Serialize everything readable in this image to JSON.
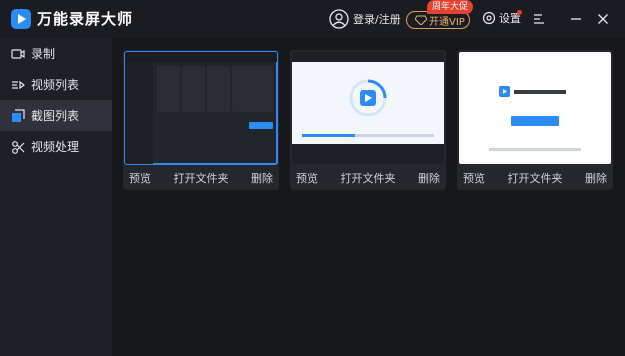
{
  "app": {
    "title": "万能录屏大师",
    "login_label": "登录/注册",
    "vip_label": "开通VIP",
    "promo_badge": "周年大促",
    "settings_label": "设置",
    "accent_color": "#2b8cf5"
  },
  "sidebar": {
    "items": [
      {
        "label": "录制",
        "icon": "record-icon"
      },
      {
        "label": "视频列表",
        "icon": "video-list-icon"
      },
      {
        "label": "截图列表",
        "icon": "screenshot-list-icon",
        "active": true
      },
      {
        "label": "视频处理",
        "icon": "video-edit-icon"
      }
    ]
  },
  "screenshots": [
    {
      "preview_label": "预览",
      "open_folder_label": "打开文件夹",
      "delete_label": "删除",
      "selected": true
    },
    {
      "preview_label": "预览",
      "open_folder_label": "打开文件夹",
      "delete_label": "删除"
    },
    {
      "preview_label": "预览",
      "open_folder_label": "打开文件夹",
      "delete_label": "删除"
    }
  ]
}
